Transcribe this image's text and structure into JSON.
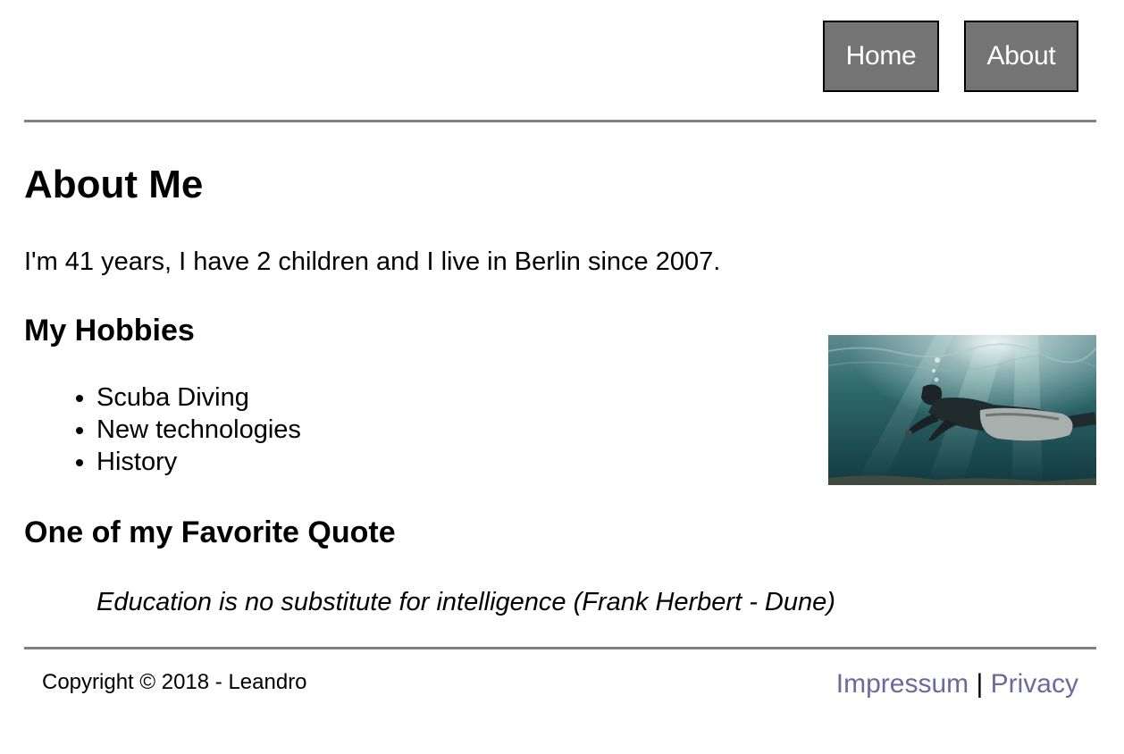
{
  "nav": {
    "home_label": "Home",
    "about_label": "About"
  },
  "main": {
    "title": "About Me",
    "intro": "I'm 41 years, I have 2 children and I live in Berlin since 2007.",
    "hobbies_title": "My Hobbies",
    "hobbies": [
      "Scuba Diving",
      "New technologies",
      "History"
    ],
    "quote_title": "One of my Favorite Quote",
    "quote": "Education is no substitute for intelligence (Frank Herbert - Dune)"
  },
  "footer": {
    "copyright": "Copyright © 2018 - Leandro",
    "impressum_label": "Impressum",
    "separator": "|",
    "privacy_label": "Privacy"
  },
  "colors": {
    "nav_button_bg": "#757474",
    "rule": "#808080",
    "footer_link": "#6b6a9c"
  }
}
